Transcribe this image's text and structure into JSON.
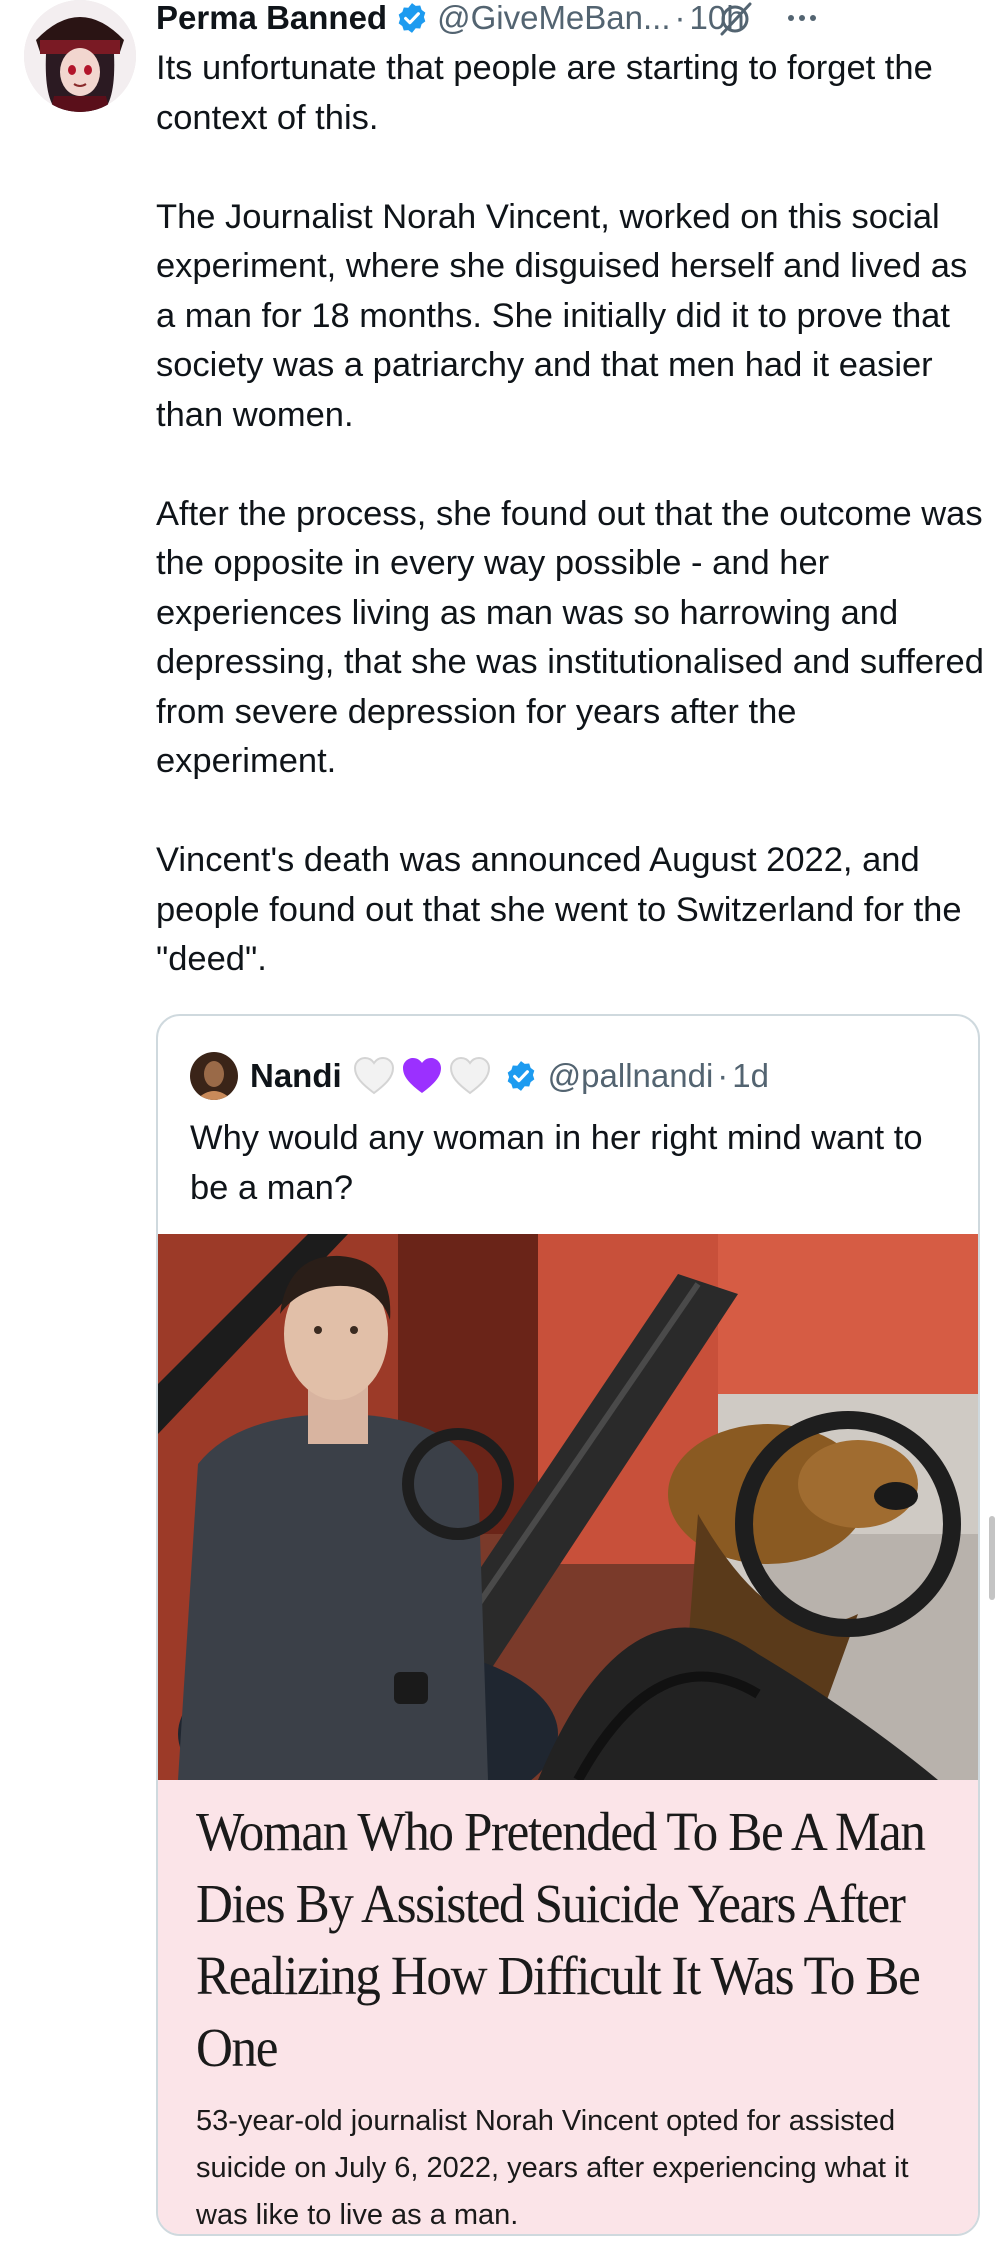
{
  "tweet": {
    "display_name": "Perma Banned",
    "handle": "@GiveMeBan...",
    "separator": "·",
    "time": "10h",
    "paragraphs": [
      "Its unfortunate that people are starting to forget the context of this.",
      "The Journalist Norah Vincent, worked on this social experiment, where she disguised herself and lived as a man for 18 months. She initially did it to prove that society was a patriarchy and that men had it easier than women.",
      "After the process, she found out that the outcome was the opposite in every way possible - and her experiences living as man was so harrowing and depressing, that she was institutionalised and suffered from severe depression for years after the experiment.",
      "Vincent's death was announced August 2022, and people found out that she went to Switzerland for the \"deed\"."
    ]
  },
  "quote": {
    "display_name": "Nandi",
    "handle": "@pallnandi",
    "separator": "·",
    "time": "1d",
    "text": "Why would any woman in her right mind want to be a man?",
    "article": {
      "headline": "Woman Who Pretended To Be A Man Dies By Assisted Suicide Years After Realizing How Difficult It Was To Be One",
      "summary": "53-year-old journalist Norah Vincent opted for assisted suicide on July 6, 2022, years after experiencing what it was like to live as a man."
    }
  },
  "colors": {
    "verified": "#1d9bf0",
    "secondary_text": "#536471",
    "border": "#cfd9de",
    "article_background": "#fbe4e8",
    "purple_heart": "#9b30ff"
  },
  "icons": [
    "verified-badge-icon",
    "grok-icon",
    "more-icon",
    "white-heart-icon",
    "purple-heart-icon"
  ]
}
